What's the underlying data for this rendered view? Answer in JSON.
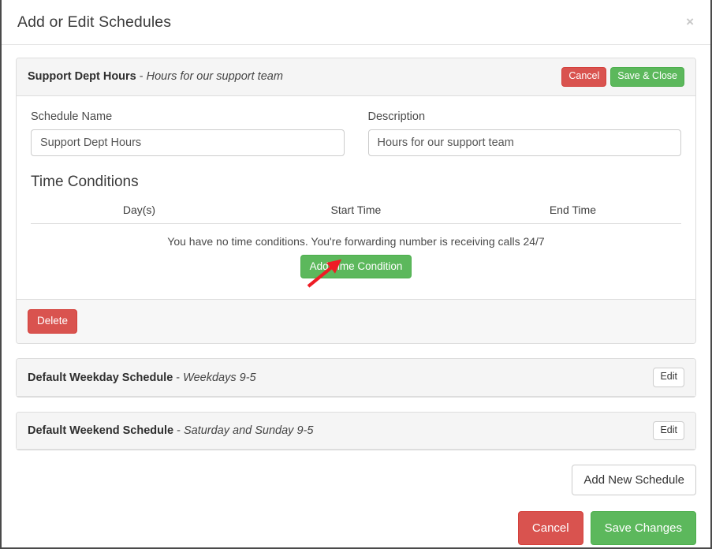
{
  "modal": {
    "title": "Add or Edit Schedules",
    "close_icon": "close-icon",
    "close_label": "×"
  },
  "active_schedule": {
    "name_strong": "Support Dept Hours",
    "separator": " - ",
    "name_sub": "Hours for our support team",
    "header_buttons": {
      "cancel": "Cancel",
      "save_close": "Save & Close"
    },
    "fields": {
      "schedule_name_label": "Schedule Name",
      "schedule_name_value": "Support Dept Hours",
      "schedule_name_placeholder": "Schedule Name",
      "description_label": "Description",
      "description_value": "Hours for our support team",
      "description_placeholder": "Description"
    },
    "time_conditions": {
      "title": "Time Conditions",
      "columns": [
        "Day(s)",
        "Start Time",
        "End Time"
      ],
      "rows": [],
      "empty_message": "You have no time conditions. You're forwarding number is receiving calls 24/7",
      "add_button": "Add Time Condition"
    },
    "footer": {
      "delete": "Delete"
    }
  },
  "other_schedules": [
    {
      "name_strong": "Default Weekday Schedule",
      "separator": " - ",
      "name_sub": "Weekdays 9-5",
      "edit_label": "Edit"
    },
    {
      "name_strong": "Default Weekend Schedule",
      "separator": " - ",
      "name_sub": "Saturday and Sunday 9-5",
      "edit_label": "Edit"
    }
  ],
  "bottom": {
    "add_new_schedule": "Add New Schedule",
    "cancel": "Cancel",
    "save_changes": "Save Changes"
  },
  "annotation": {
    "type": "arrow",
    "color": "#ee1c25",
    "points_to": "Add Time Condition"
  },
  "colors": {
    "danger": "#d9534f",
    "success": "#5cb85c",
    "panel_header_bg": "#f5f5f5",
    "border": "#dddddd",
    "text": "#333333",
    "annotation_red": "#ee1c25"
  }
}
